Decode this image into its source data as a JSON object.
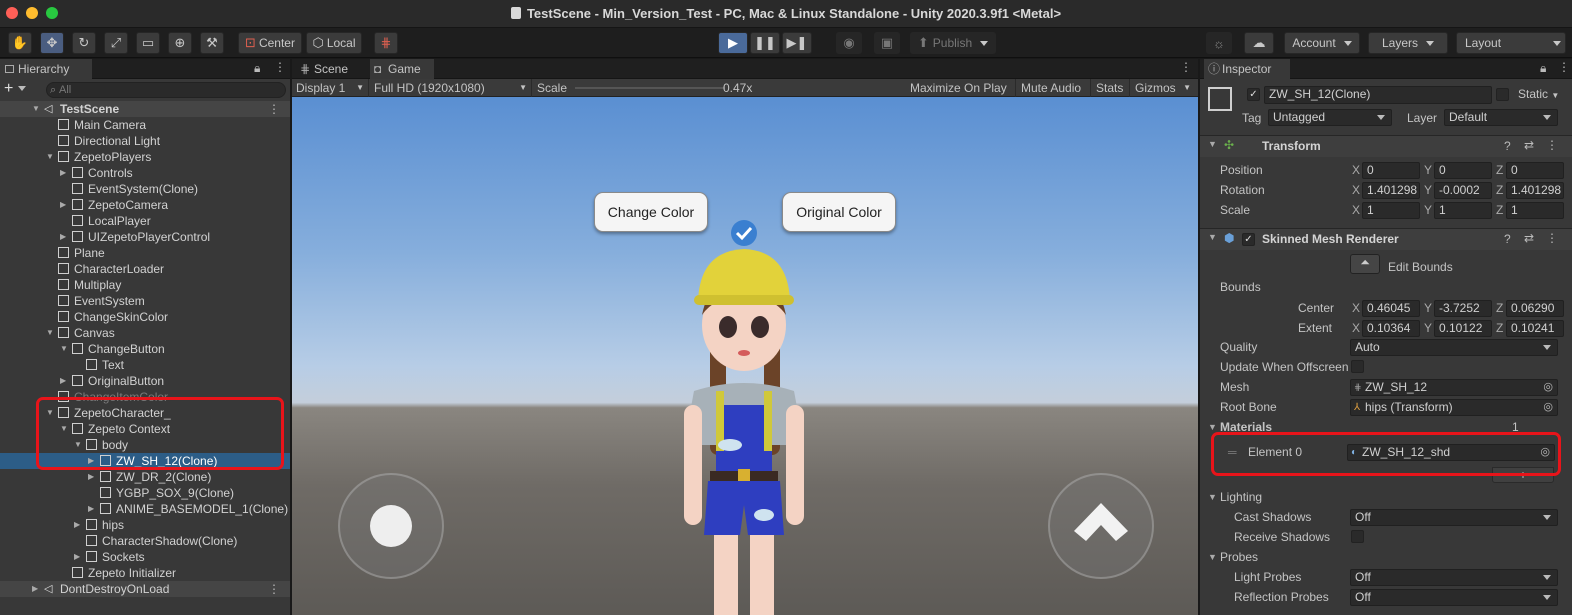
{
  "window": {
    "title": "TestScene - Min_Version_Test - PC, Mac & Linux Standalone - Unity 2020.3.9f1 <Metal>"
  },
  "toolbar": {
    "pivot_label": "Center",
    "space_label": "Local",
    "publish_label": "Publish",
    "account_label": "Account",
    "layers_label": "Layers",
    "layout_label": "Layout"
  },
  "hierarchy": {
    "tab_label": "Hierarchy",
    "search_placeholder": "All",
    "rows": [
      {
        "label": "TestScene"
      },
      {
        "label": "Main Camera"
      },
      {
        "label": "Directional Light"
      },
      {
        "label": "ZepetoPlayers"
      },
      {
        "label": "Controls"
      },
      {
        "label": "EventSystem(Clone)"
      },
      {
        "label": "ZepetoCamera"
      },
      {
        "label": "LocalPlayer"
      },
      {
        "label": "UIZepetoPlayerControl"
      },
      {
        "label": "Plane"
      },
      {
        "label": "CharacterLoader"
      },
      {
        "label": "Multiplay"
      },
      {
        "label": "EventSystem"
      },
      {
        "label": "ChangeSkinColor"
      },
      {
        "label": "Canvas"
      },
      {
        "label": "ChangeButton"
      },
      {
        "label": "Text"
      },
      {
        "label": "OriginalButton"
      },
      {
        "label": "ChangeItemColor"
      },
      {
        "label": "ZepetoCharacter_"
      },
      {
        "label": "Zepeto Context"
      },
      {
        "label": "body"
      },
      {
        "label": "ZW_SH_12(Clone)"
      },
      {
        "label": "ZW_DR_2(Clone)"
      },
      {
        "label": "YGBP_SOX_9(Clone)"
      },
      {
        "label": "ANIME_BASEMODEL_1(Clone)"
      },
      {
        "label": "hips"
      },
      {
        "label": "CharacterShadow(Clone)"
      },
      {
        "label": "Sockets"
      },
      {
        "label": "Zepeto Initializer"
      },
      {
        "label": "DontDestroyOnLoad"
      }
    ]
  },
  "game": {
    "scene_tab": "Scene",
    "game_tab": "Game",
    "display": "Display 1",
    "resolution": "Full HD (1920x1080)",
    "scale_label": "Scale",
    "scale_value": "0.47x",
    "maximize": "Maximize On Play",
    "mute": "Mute Audio",
    "stats": "Stats",
    "gizmos": "Gizmos",
    "change_color_button": "Change Color",
    "original_color_button": "Original Color"
  },
  "inspector": {
    "tab_label": "Inspector",
    "object_name": "ZW_SH_12(Clone)",
    "static_label": "Static",
    "tag_label": "Tag",
    "tag_value": "Untagged",
    "layer_label": "Layer",
    "layer_value": "Default",
    "transform": {
      "title": "Transform",
      "position_label": "Position",
      "rotation_label": "Rotation",
      "scale_label": "Scale",
      "position": [
        "0",
        "0",
        "0"
      ],
      "rotation": [
        "1.401298",
        "-0.0002",
        "1.401298"
      ],
      "scale": [
        "1",
        "1",
        "1"
      ]
    },
    "smr": {
      "title": "Skinned Mesh Renderer",
      "edit_bounds": "Edit Bounds",
      "bounds_label": "Bounds",
      "center_label": "Center",
      "extent_label": "Extent",
      "center": [
        "0.46045",
        "-3.7252",
        "0.06290"
      ],
      "extent": [
        "0.10364",
        "0.10122",
        "0.10241"
      ],
      "quality_label": "Quality",
      "quality_value": "Auto",
      "update_offscreen_label": "Update When Offscreen",
      "mesh_label": "Mesh",
      "mesh_value": "ZW_SH_12",
      "root_bone_label": "Root Bone",
      "root_bone_value": "hips (Transform)",
      "materials_label": "Materials",
      "materials_count": "1",
      "element0_label": "Element 0",
      "element0_value": "ZW_SH_12_shd",
      "lighting_label": "Lighting",
      "cast_shadows_label": "Cast Shadows",
      "cast_shadows_value": "Off",
      "receive_shadows_label": "Receive Shadows",
      "probes_label": "Probes",
      "light_probes_label": "Light Probes",
      "light_probes_value": "Off",
      "reflection_probes_label": "Reflection Probes",
      "reflection_probes_value": "Off"
    }
  },
  "axis_labels": {
    "x": "X",
    "y": "Y",
    "z": "Z"
  }
}
